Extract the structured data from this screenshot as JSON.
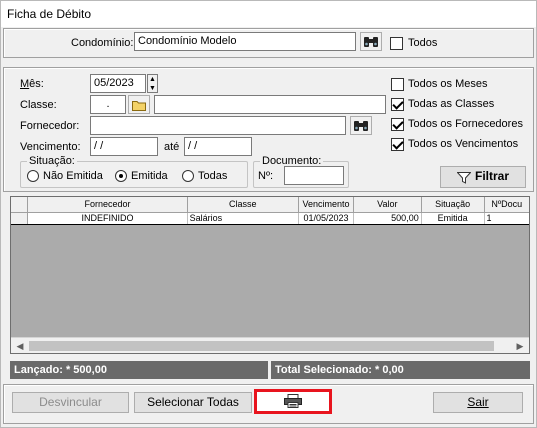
{
  "window": {
    "title": "Ficha de Débito"
  },
  "condominio": {
    "label": "Condomínio:",
    "value": "Condomínio Modelo",
    "todos_label": "Todos",
    "todos_checked": false
  },
  "filters": {
    "mes_label": "Mês:",
    "mes_value": "05/2023",
    "classe_label": "Classe:",
    "classe_code": ".",
    "classe_desc": "",
    "fornecedor_label": "Fornecedor:",
    "fornecedor_value": "",
    "vencimento_label": "Vencimento:",
    "vencimento_from": " / /",
    "ate_label": "até",
    "vencimento_to": " / /",
    "situacao": {
      "title": "Situação:",
      "options": [
        "Não Emitida",
        "Emitida",
        "Todas"
      ],
      "selected": "Emitida"
    },
    "documento": {
      "title": "Documento:",
      "numero_label": "Nº:",
      "numero_value": ""
    },
    "checks": [
      {
        "label": "Todos os Meses",
        "checked": false
      },
      {
        "label": "Todas as Classes",
        "checked": true
      },
      {
        "label": "Todos os Fornecedores",
        "checked": true
      },
      {
        "label": "Todos os Vencimentos",
        "checked": true
      }
    ],
    "filtrar_label": "Filtrar"
  },
  "grid": {
    "columns": [
      "Fornecedor",
      "Classe",
      "Vencimento",
      "Valor",
      "Situação",
      "NºDocu"
    ],
    "rows": [
      {
        "fornecedor": "INDEFINIDO",
        "classe": "Salários",
        "vencimento": "01/05/2023",
        "valor": "500,00",
        "situacao": "Emitida",
        "numdoc": "1"
      }
    ]
  },
  "summary": {
    "lancado": "Lançado: * 500,00",
    "total_selecionado": "Total Selecionado: * 0,00"
  },
  "buttons": {
    "desvincular": "Desvincular",
    "selecionar_todas": "Selecionar Todas",
    "sair": "Sair"
  },
  "icons": {
    "binoculars": "binoculars-icon",
    "folder": "folder-icon",
    "printer": "printer-icon",
    "filter": "filter-icon"
  },
  "colors": {
    "highlight": "#e8141e",
    "summary_bg": "#6a6a6a"
  }
}
